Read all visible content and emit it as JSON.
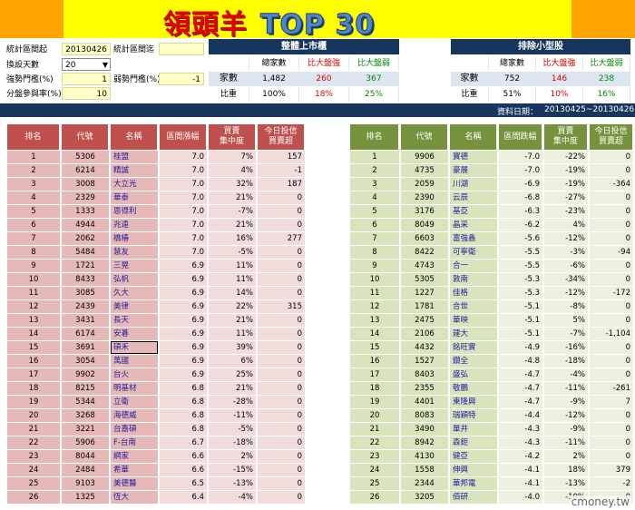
{
  "banner": {
    "title": "領頭羊",
    "top30": "TOP 30"
  },
  "controls": {
    "stat_start_label": "統計區間起",
    "stat_start_value": "20130426",
    "stat_end_label": "統計區間迄",
    "stat_end_value": "",
    "days_label": "換設天數",
    "days_value": "20",
    "strong_threshold_label": "強勢門檻(%)",
    "strong_threshold_value": "1",
    "weak_threshold_label": "弱勢門檻(%)",
    "weak_threshold_value": "-1",
    "participation_label": "分盤參與率(%)",
    "participation_value": "10"
  },
  "summary_all": {
    "title": "整體上市櫃",
    "h_total": "總家數",
    "h_strong": "比大盤強",
    "h_weak": "比大盤弱",
    "row_label": "家數",
    "total": "1,482",
    "strong": "260",
    "weak": "367",
    "ratio_label": "比重",
    "total_pct": "100%",
    "strong_pct": "18%",
    "weak_pct": "25%"
  },
  "summary_small": {
    "title": "排除小型股",
    "h_total": "總家數",
    "h_strong": "比大盤強",
    "h_weak": "比大盤弱",
    "row_label": "家數",
    "total": "752",
    "strong": "146",
    "weak": "238",
    "ratio_label": "比重",
    "total_pct": "51%",
    "strong_pct": "10%",
    "weak_pct": "16%"
  },
  "date_range": {
    "label": "資料日期：",
    "value": "20130425~20130426"
  },
  "left_headers": [
    "排名",
    "代號",
    "名稱",
    "區間漲幅",
    "買賣\n集中度",
    "今日投信\n買賣超"
  ],
  "right_headers": [
    "排名",
    "代號",
    "名稱",
    "區間跌幅",
    "買賣\n集中度",
    "今日投信\n買賣超"
  ],
  "left_rows": [
    [
      "1",
      "5306",
      "桂盟",
      "7.0",
      "7%",
      "157"
    ],
    [
      "2",
      "6214",
      "精誠",
      "7.0",
      "4%",
      "-1"
    ],
    [
      "3",
      "3008",
      "大立光",
      "7.0",
      "32%",
      "187"
    ],
    [
      "4",
      "2329",
      "華泰",
      "7.0",
      "21%",
      "0"
    ],
    [
      "5",
      "1333",
      "恩得利",
      "7.0",
      "-7%",
      "0"
    ],
    [
      "6",
      "4944",
      "兆遠",
      "7.0",
      "21%",
      "0"
    ],
    [
      "7",
      "2062",
      "橋椿",
      "7.0",
      "16%",
      "277"
    ],
    [
      "8",
      "5484",
      "慧友",
      "7.0",
      "-5%",
      "0"
    ],
    [
      "9",
      "1721",
      "三晃",
      "6.9",
      "11%",
      "0"
    ],
    [
      "10",
      "8433",
      "弘帆",
      "6.9",
      "11%",
      "0"
    ],
    [
      "11",
      "3085",
      "久大",
      "6.9",
      "14%",
      "0"
    ],
    [
      "12",
      "2439",
      "美律",
      "6.9",
      "22%",
      "315"
    ],
    [
      "13",
      "3431",
      "長天",
      "6.9",
      "21%",
      "0"
    ],
    [
      "14",
      "6174",
      "安碁",
      "6.9",
      "11%",
      "0"
    ],
    [
      "15",
      "3691",
      "碩禾",
      "6.9",
      "39%",
      "0"
    ],
    [
      "16",
      "3054",
      "萬國",
      "6.9",
      "6%",
      "0"
    ],
    [
      "17",
      "9902",
      "台火",
      "6.9",
      "25%",
      "0"
    ],
    [
      "18",
      "8215",
      "明基材",
      "6.8",
      "21%",
      "0"
    ],
    [
      "19",
      "5344",
      "立衛",
      "6.8",
      "-28%",
      "0"
    ],
    [
      "20",
      "3268",
      "海德威",
      "6.8",
      "-11%",
      "0"
    ],
    [
      "21",
      "3221",
      "台嘉碩",
      "6.8",
      "-5%",
      "0"
    ],
    [
      "22",
      "5906",
      "F-台南",
      "6.7",
      "-18%",
      "0"
    ],
    [
      "23",
      "8044",
      "網家",
      "6.6",
      "2%",
      "0"
    ],
    [
      "24",
      "2484",
      "希華",
      "6.6",
      "-15%",
      "0"
    ],
    [
      "25",
      "9103",
      "美德醫",
      "6.5",
      "-13%",
      "0"
    ],
    [
      "26",
      "1325",
      "恆大",
      "6.4",
      "-4%",
      "0"
    ]
  ],
  "right_rows": [
    [
      "1",
      "9906",
      "寶德",
      "-7.0",
      "-22%",
      "0"
    ],
    [
      "2",
      "4735",
      "豪展",
      "-7.0",
      "-19%",
      "0"
    ],
    [
      "3",
      "2059",
      "川湖",
      "-6.9",
      "-19%",
      "-364"
    ],
    [
      "4",
      "2390",
      "云辰",
      "-6.8",
      "-27%",
      "0"
    ],
    [
      "5",
      "3176",
      "基亞",
      "-6.3",
      "-23%",
      "0"
    ],
    [
      "6",
      "8049",
      "晶采",
      "-6.2",
      "4%",
      "0"
    ],
    [
      "7",
      "6603",
      "富強鑫",
      "-5.6",
      "-12%",
      "0"
    ],
    [
      "8",
      "8422",
      "可寧衛",
      "-5.5",
      "-3%",
      "-94"
    ],
    [
      "9",
      "4743",
      "合一",
      "-5.5",
      "-6%",
      "0"
    ],
    [
      "10",
      "5305",
      "敦南",
      "-5.3",
      "-34%",
      "0"
    ],
    [
      "11",
      "1227",
      "佳格",
      "-5.3",
      "-12%",
      "-172"
    ],
    [
      "12",
      "1781",
      "合世",
      "-5.1",
      "-8%",
      "0"
    ],
    [
      "13",
      "2475",
      "華映",
      "-5.1",
      "5%",
      "0"
    ],
    [
      "14",
      "2106",
      "建大",
      "-5.1",
      "-7%",
      "-1,104"
    ],
    [
      "15",
      "4432",
      "銘旺實",
      "-4.9",
      "-16%",
      "0"
    ],
    [
      "16",
      "1527",
      "鑽全",
      "-4.8",
      "-18%",
      "0"
    ],
    [
      "17",
      "8403",
      "盛弘",
      "-4.7",
      "-4%",
      "0"
    ],
    [
      "18",
      "2355",
      "敬鵬",
      "-4.7",
      "-11%",
      "-261"
    ],
    [
      "19",
      "4401",
      "東隆興",
      "-4.7",
      "-9%",
      "7"
    ],
    [
      "20",
      "8083",
      "瑞穎特",
      "-4.4",
      "-12%",
      "0"
    ],
    [
      "21",
      "3490",
      "單井",
      "-4.3",
      "-9%",
      "0"
    ],
    [
      "22",
      "8942",
      "森鉅",
      "-4.3",
      "-11%",
      "0"
    ],
    [
      "23",
      "4130",
      "健亞",
      "-4.2",
      "2%",
      "0"
    ],
    [
      "24",
      "1558",
      "伸興",
      "-4.1",
      "18%",
      "379"
    ],
    [
      "25",
      "2344",
      "華邦電",
      "-4.1",
      "-13%",
      "-2"
    ],
    [
      "26",
      "3205",
      "佰研",
      "-4.0",
      "-10%",
      "0"
    ]
  ],
  "watermark": "cmoney.tw"
}
